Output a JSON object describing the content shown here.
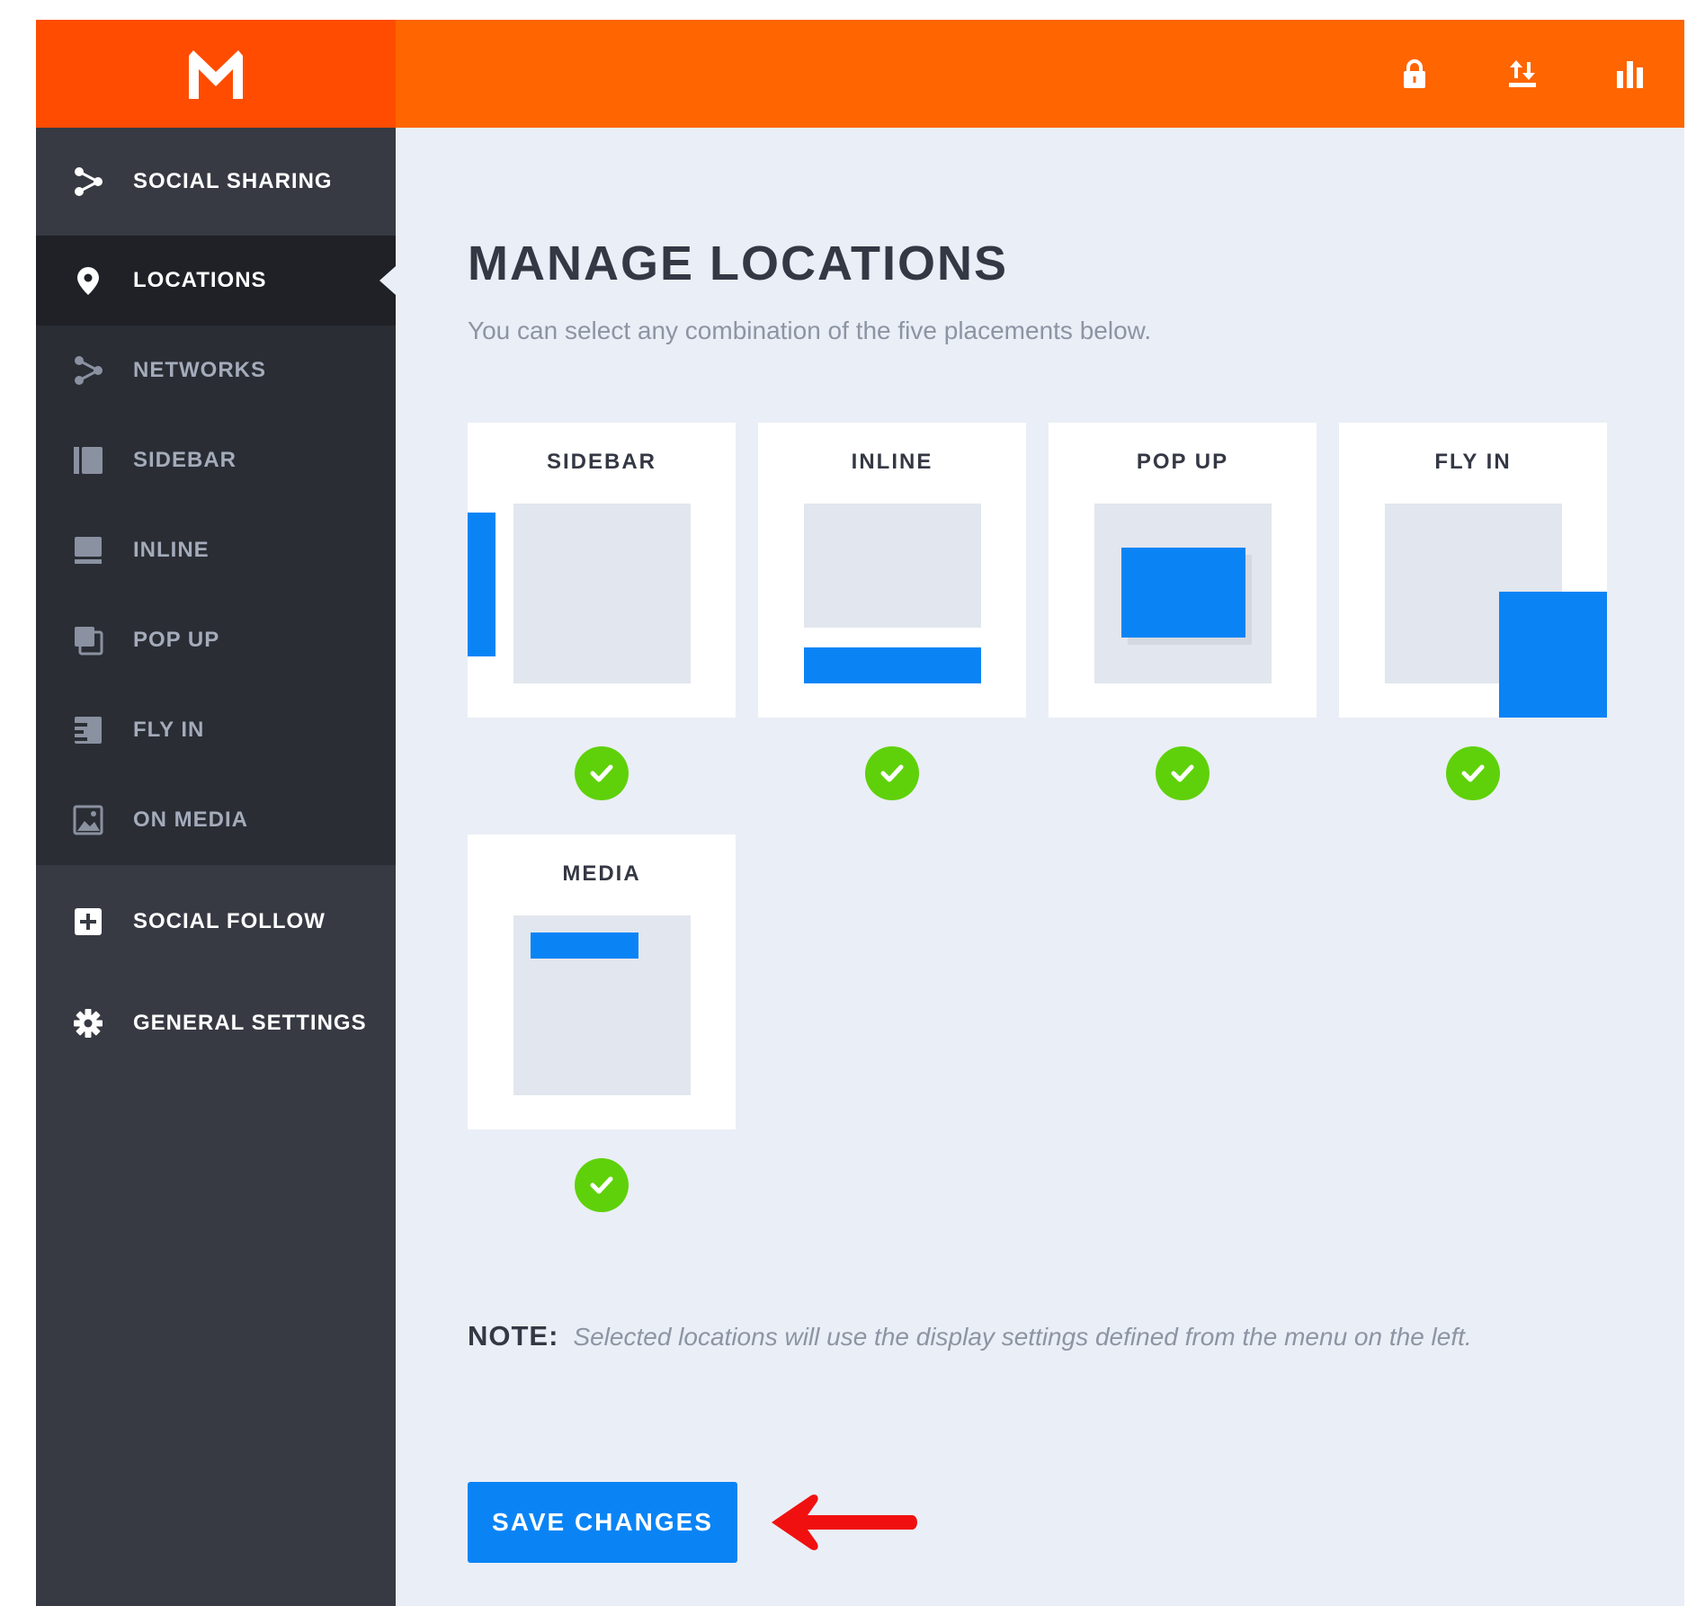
{
  "header": {
    "logo_icon": "m-logo-icon",
    "icons": [
      "lock-icon",
      "import-export-icon",
      "bar-chart-icon"
    ],
    "colors": {
      "header": "#ff6500",
      "logo_box": "#ff4c00"
    }
  },
  "sidebar": {
    "social_sharing": "SOCIAL SHARING",
    "items": [
      {
        "label": "LOCATIONS",
        "icon": "location-pin-icon"
      },
      {
        "label": "NETWORKS",
        "icon": "share-icon"
      },
      {
        "label": "SIDEBAR",
        "icon": "sidebar-layout-icon"
      },
      {
        "label": "INLINE",
        "icon": "inline-layout-icon"
      },
      {
        "label": "POP UP",
        "icon": "popup-layout-icon"
      },
      {
        "label": "FLY IN",
        "icon": "flyin-layout-icon"
      },
      {
        "label": "ON MEDIA",
        "icon": "image-icon"
      }
    ],
    "social_follow": "SOCIAL FOLLOW",
    "general_settings": "GENERAL SETTINGS"
  },
  "main": {
    "title": "MANAGE LOCATIONS",
    "subtitle": "You can select any combination of the five placements below.",
    "cards": [
      {
        "title": "SIDEBAR",
        "selected": true
      },
      {
        "title": "INLINE",
        "selected": true
      },
      {
        "title": "POP UP",
        "selected": true
      },
      {
        "title": "FLY IN",
        "selected": true
      },
      {
        "title": "MEDIA",
        "selected": true
      }
    ],
    "note_label": "NOTE:",
    "note_text": "Selected locations will use the display settings defined from the menu on the left.",
    "save_label": "SAVE CHANGES",
    "colors": {
      "accent_blue": "#0a84f5",
      "check_green": "#5fd10a",
      "arrow_red": "#f01010"
    }
  }
}
